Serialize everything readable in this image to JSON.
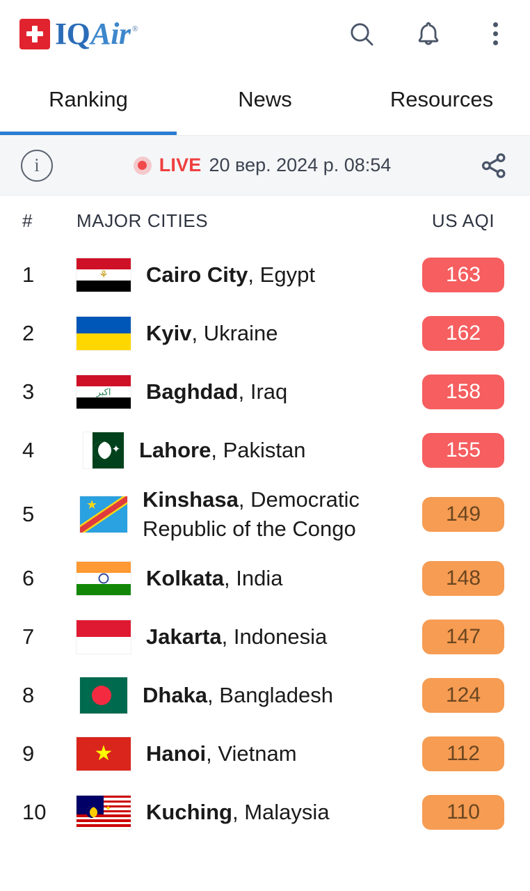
{
  "header": {
    "brand_iq": "IQ",
    "brand_air": "Air",
    "brand_reg": "®",
    "search_icon": "search-icon",
    "bell_icon": "bell-icon",
    "menu_icon": "kebab-menu-icon",
    "logo_color": "#e0232e",
    "brand_color": "#2b6cb8"
  },
  "tabs": [
    {
      "label": "Ranking",
      "active": true
    },
    {
      "label": "News",
      "active": false
    },
    {
      "label": "Resources",
      "active": false
    }
  ],
  "tab_accent_color": "#2b7cd3",
  "livebar": {
    "info_icon": "info-icon",
    "info_glyph": "i",
    "live_label": "LIVE",
    "timestamp": "20 вер. 2024 р. 08:54",
    "share_icon": "share-icon",
    "live_color": "#ef3f3f",
    "background": "#f5f6f8"
  },
  "table": {
    "headers": {
      "rank": "#",
      "city": "MAJOR CITIES",
      "aqi": "US AQI"
    },
    "rows": [
      {
        "rank": "1",
        "city": "Cairo City",
        "separator": ", ",
        "country": "Egypt",
        "aqi": "163",
        "level": "red",
        "flag": "eg",
        "flag_shape": "wide"
      },
      {
        "rank": "2",
        "city": "Kyiv",
        "separator": ", ",
        "country": "Ukraine",
        "aqi": "162",
        "level": "red",
        "flag": "ua",
        "flag_shape": "wide"
      },
      {
        "rank": "3",
        "city": "Baghdad",
        "separator": ", ",
        "country": "Iraq",
        "aqi": "158",
        "level": "red",
        "flag": "iq",
        "flag_shape": "wide"
      },
      {
        "rank": "4",
        "city": "Lahore",
        "separator": ", ",
        "country": "Pakistan",
        "aqi": "155",
        "level": "red",
        "flag": "pk",
        "flag_shape": "square"
      },
      {
        "rank": "5",
        "city": "Kinshasa",
        "separator": ", ",
        "country": "Democratic Republic of the Congo",
        "aqi": "149",
        "level": "orange",
        "flag": "cd",
        "flag_shape": "square2"
      },
      {
        "rank": "6",
        "city": "Kolkata",
        "separator": ", ",
        "country": "India",
        "aqi": "148",
        "level": "orange",
        "flag": "in",
        "flag_shape": "wide"
      },
      {
        "rank": "7",
        "city": "Jakarta",
        "separator": ", ",
        "country": "Indonesia",
        "aqi": "147",
        "level": "orange",
        "flag": "id",
        "flag_shape": "wide"
      },
      {
        "rank": "8",
        "city": "Dhaka",
        "separator": ", ",
        "country": "Bangladesh",
        "aqi": "124",
        "level": "orange",
        "flag": "bd",
        "flag_shape": "square2"
      },
      {
        "rank": "9",
        "city": "Hanoi",
        "separator": ", ",
        "country": "Vietnam",
        "aqi": "112",
        "level": "orange",
        "flag": "vn",
        "flag_shape": "wide"
      },
      {
        "rank": "10",
        "city": "Kuching",
        "separator": ", ",
        "country": "Malaysia",
        "aqi": "110",
        "level": "orange",
        "flag": "my",
        "flag_shape": "wide"
      }
    ]
  },
  "aqi_colors": {
    "red_bg": "#f65e5f",
    "red_text": "#ffffff",
    "orange_bg": "#f69c53",
    "orange_text": "#6b4620"
  }
}
